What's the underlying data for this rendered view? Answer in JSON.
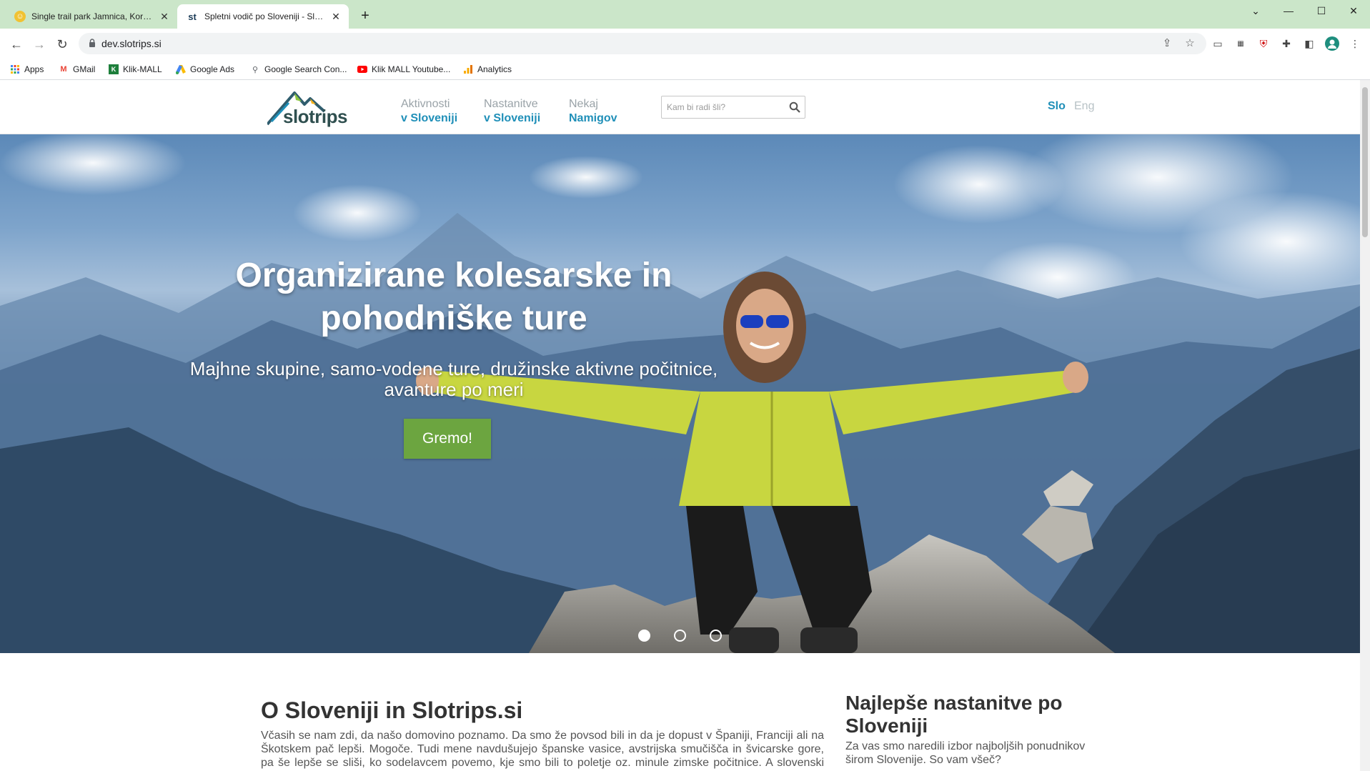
{
  "browser": {
    "tabs": [
      {
        "title": "Single trail park Jamnica, Koroška",
        "active": false
      },
      {
        "title": "Spletni vodič po Sloveniji - Slotrips",
        "active": true,
        "favicon_text": "st"
      }
    ],
    "url": "dev.slotrips.si",
    "bookmarks": [
      {
        "label": "Apps",
        "icon": "apps-grid-icon"
      },
      {
        "label": "GMail",
        "icon": "gmail-icon"
      },
      {
        "label": "Klik-MALL",
        "icon": "klik-mall-icon"
      },
      {
        "label": "Google Ads",
        "icon": "google-ads-icon"
      },
      {
        "label": "Google Search Con...",
        "icon": "search-console-icon"
      },
      {
        "label": "Klik MALL Youtube...",
        "icon": "youtube-icon"
      },
      {
        "label": "Analytics",
        "icon": "analytics-icon"
      }
    ],
    "colors": {
      "tabstrip": "#cbe6c9",
      "omnibox": "#f1f3f4"
    }
  },
  "site": {
    "brand": "slotrips",
    "menu": [
      {
        "line1": "Aktivnosti",
        "line2": "v Sloveniji"
      },
      {
        "line1": "Nastanitve",
        "line2": "v Sloveniji"
      },
      {
        "line1": "Nekaj",
        "line2": "Namigov"
      }
    ],
    "search_placeholder": "Kam bi radi šli?",
    "languages": {
      "active": "Slo",
      "other": "Eng"
    },
    "hero": {
      "title": "Organizirane kolesarske in pohodniške ture",
      "subtitle": "Majhne skupine, samo-vodene ture, družinske aktivne počitnice, avanture po meri",
      "button": "Gremo!",
      "slides": 3,
      "active_slide": 1
    },
    "about": {
      "heading": "O Sloveniji in Slotrips.si",
      "text": "Včasih se nam zdi, da našo domovino poznamo. Da smo že povsod bili in da je dopust v Španiji, Franciji ali na Škotskem pač lepši. Mogoče. Tudi mene navdušujejo španske vasice, avstrijska smučišča in švicarske gore, pa še lepše se sliši, ko sodelavcem povemo, kje smo bili to poletje oz. minule zimske počitnice. A slovenski turizem ni le Bled in Postojnska jama, Triglav ni edina gora v naši deželi in prelaz Vršič ni edini"
    },
    "accommodation": {
      "heading": "Najlepše nastanitve po Sloveniji",
      "text": "Za vas smo naredili izbor najboljših ponudnikov širom Slovenije. So vam všeč?"
    },
    "colors": {
      "accent": "#1f8fb8",
      "button": "#6ca540",
      "muted": "#9aa3a8"
    }
  }
}
